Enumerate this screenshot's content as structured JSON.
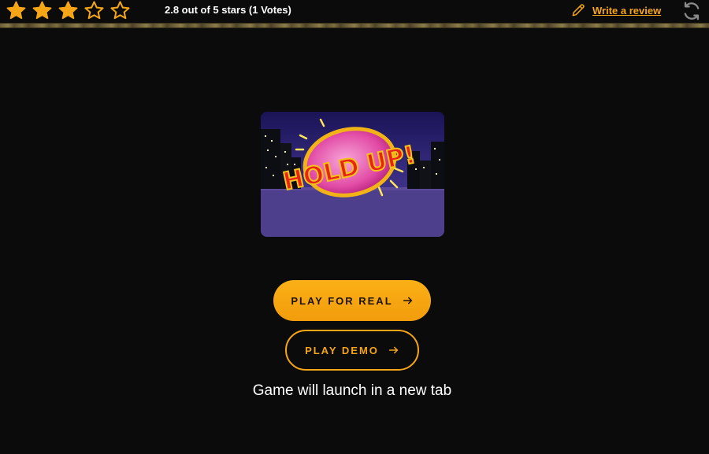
{
  "rating": {
    "value": 2.8,
    "max": 5,
    "filled_stars": 3,
    "text": "2.8 out of 5 stars (1 Votes)",
    "star_color": "#f5a516",
    "icons": [
      "star-filled-icon",
      "star-filled-icon",
      "star-filled-icon",
      "star-outline-icon",
      "star-outline-icon"
    ]
  },
  "review": {
    "label": "Write a review",
    "icon": "pencil-icon"
  },
  "refresh": {
    "icon": "refresh-icon"
  },
  "game": {
    "logo_text": "HOLD UP!"
  },
  "actions": {
    "play_real_label": "PLAY FOR REAL",
    "play_demo_label": "PLAY DEMO",
    "arrow_icon": "arrow-right-icon",
    "accent": "#f5a516"
  },
  "note": "Game will launch in a new tab"
}
